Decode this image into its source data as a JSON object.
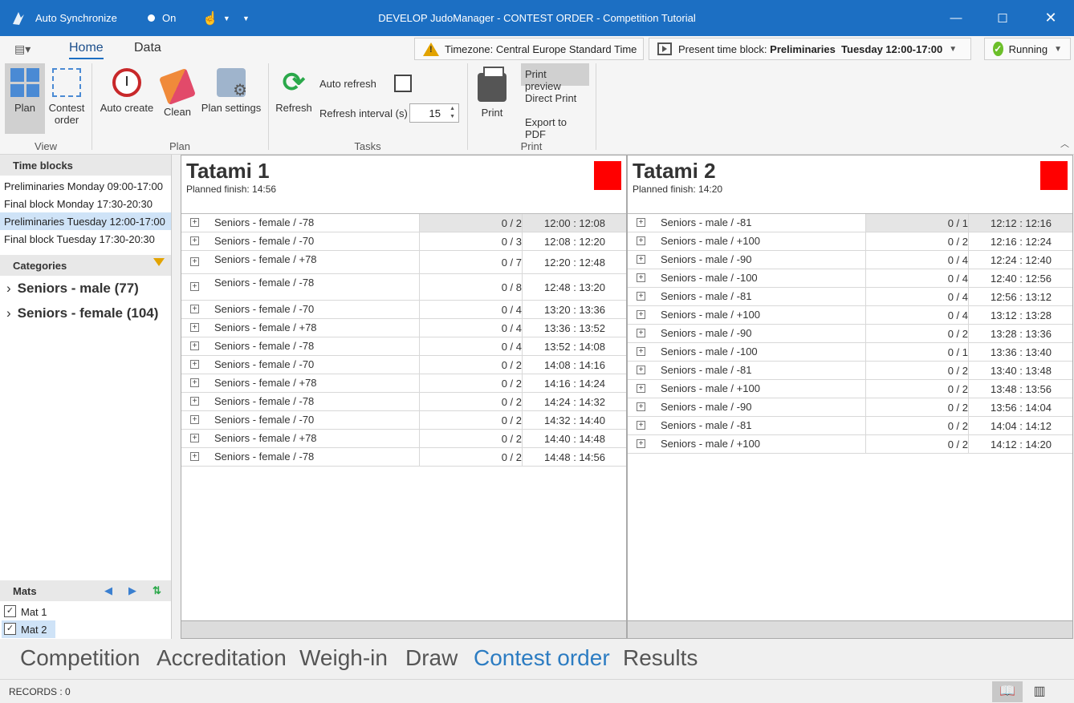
{
  "titlebar": {
    "auto_sync_label": "Auto Synchronize",
    "toggle_label": "On",
    "title": "DEVELOP JudoManager - CONTEST ORDER - Competition Tutorial"
  },
  "ribbon": {
    "tabs": [
      "Home",
      "Data"
    ],
    "timezone": "Timezone: Central Europe Standard Time",
    "time_block_prefix": "Present time block: ",
    "time_block_value": "Preliminaries  Tuesday 12:00-17:00",
    "status": "Running",
    "view": {
      "plan": "Plan",
      "contest_order_1": "Contest",
      "contest_order_2": "order",
      "label": "View"
    },
    "plan": {
      "auto_create": "Auto create",
      "clean": "Clean",
      "plan_settings": "Plan settings",
      "label": "Plan"
    },
    "tasks": {
      "refresh": "Refresh",
      "auto_refresh": "Auto refresh",
      "refresh_interval": "Refresh interval (s)",
      "interval_value": "15",
      "label": "Tasks"
    },
    "print": {
      "print": "Print",
      "print_preview": "Print preview",
      "direct_print": "Direct Print",
      "export_pdf": "Export to PDF",
      "label": "Print"
    }
  },
  "left": {
    "time_blocks_header": "Time blocks",
    "time_blocks": [
      "Preliminaries  Monday 09:00-17:00",
      "Final block  Monday 17:30-20:30",
      "Preliminaries  Tuesday 12:00-17:00",
      "Final block  Tuesday 17:30-20:30"
    ],
    "categories_header": "Categories",
    "categories": [
      "Seniors - male (77)",
      "Seniors - female (104)"
    ],
    "mats_header": "Mats",
    "mats": [
      "Mat 1",
      "Mat 2"
    ]
  },
  "tatami1": {
    "name": "Tatami 1",
    "finish": "Planned finish: 14:56",
    "rows": [
      {
        "cat": "Seniors - female / -78",
        "cnt": "0 / 2",
        "time": "12:00 : 12:08"
      },
      {
        "cat": "Seniors - female / -70",
        "cnt": "0 / 3",
        "time": "12:08 : 12:20"
      },
      {
        "cat": "Seniors - female / +78",
        "cnt": "0 / 7",
        "time": "12:20 : 12:48"
      },
      {
        "cat": "Seniors - female / -78",
        "cnt": "0 / 8",
        "time": "12:48 : 13:20"
      },
      {
        "cat": "Seniors - female / -70",
        "cnt": "0 / 4",
        "time": "13:20 : 13:36"
      },
      {
        "cat": "Seniors - female / +78",
        "cnt": "0 / 4",
        "time": "13:36 : 13:52"
      },
      {
        "cat": "Seniors - female / -78",
        "cnt": "0 / 4",
        "time": "13:52 : 14:08"
      },
      {
        "cat": "Seniors - female / -70",
        "cnt": "0 / 2",
        "time": "14:08 : 14:16"
      },
      {
        "cat": "Seniors - female / +78",
        "cnt": "0 / 2",
        "time": "14:16 : 14:24"
      },
      {
        "cat": "Seniors - female / -78",
        "cnt": "0 / 2",
        "time": "14:24 : 14:32"
      },
      {
        "cat": "Seniors - female / -70",
        "cnt": "0 / 2",
        "time": "14:32 : 14:40"
      },
      {
        "cat": "Seniors - female / +78",
        "cnt": "0 / 2",
        "time": "14:40 : 14:48"
      },
      {
        "cat": "Seniors - female / -78",
        "cnt": "0 / 2",
        "time": "14:48 : 14:56"
      }
    ]
  },
  "tatami2": {
    "name": "Tatami 2",
    "finish": "Planned finish: 14:20",
    "rows": [
      {
        "cat": "Seniors - male / -81",
        "cnt": "0 / 1",
        "time": "12:12 : 12:16"
      },
      {
        "cat": "Seniors - male / +100",
        "cnt": "0 / 2",
        "time": "12:16 : 12:24"
      },
      {
        "cat": "Seniors - male / -90",
        "cnt": "0 / 4",
        "time": "12:24 : 12:40"
      },
      {
        "cat": "Seniors - male / -100",
        "cnt": "0 / 4",
        "time": "12:40 : 12:56"
      },
      {
        "cat": "Seniors - male / -81",
        "cnt": "0 / 4",
        "time": "12:56 : 13:12"
      },
      {
        "cat": "Seniors - male / +100",
        "cnt": "0 / 4",
        "time": "13:12 : 13:28"
      },
      {
        "cat": "Seniors - male / -90",
        "cnt": "0 / 2",
        "time": "13:28 : 13:36"
      },
      {
        "cat": "Seniors - male / -100",
        "cnt": "0 / 1",
        "time": "13:36 : 13:40"
      },
      {
        "cat": "Seniors - male / -81",
        "cnt": "0 / 2",
        "time": "13:40 : 13:48"
      },
      {
        "cat": "Seniors - male / +100",
        "cnt": "0 / 2",
        "time": "13:48 : 13:56"
      },
      {
        "cat": "Seniors - male / -90",
        "cnt": "0 / 2",
        "time": "13:56 : 14:04"
      },
      {
        "cat": "Seniors - male / -81",
        "cnt": "0 / 2",
        "time": "14:04 : 14:12"
      },
      {
        "cat": "Seniors - male / +100",
        "cnt": "0 / 2",
        "time": "14:12 : 14:20"
      }
    ]
  },
  "bottomnav": [
    "Competition",
    "Accreditation",
    "Weigh-in",
    "Draw",
    "Contest order",
    "Results"
  ],
  "status": {
    "records": "RECORDS : 0"
  }
}
